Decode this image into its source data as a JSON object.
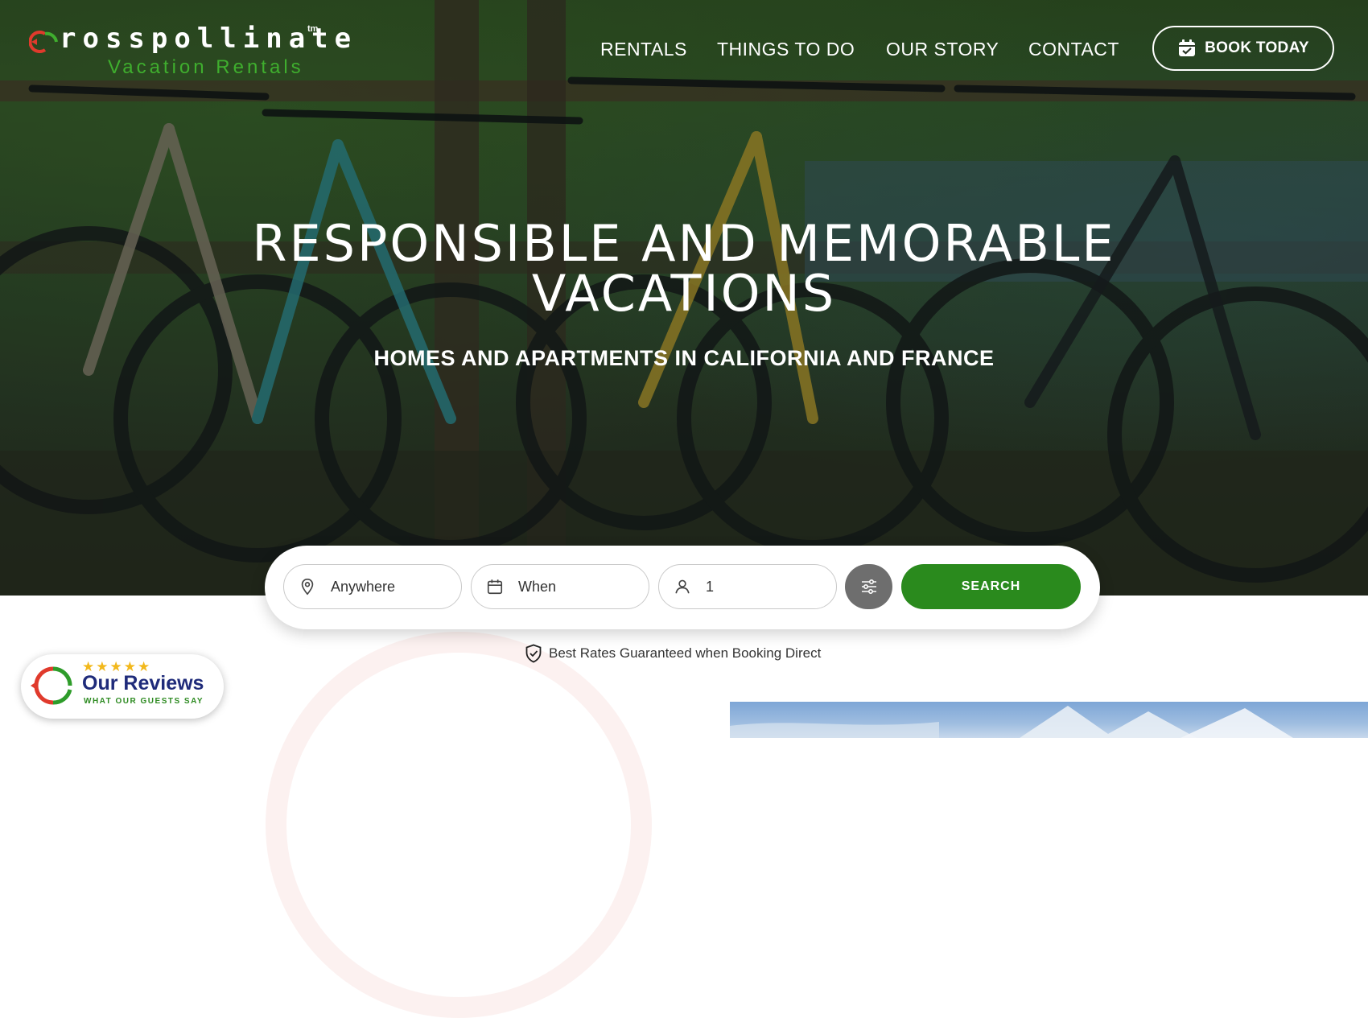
{
  "brand": {
    "name": "rosspollinate",
    "tm": "tm",
    "subtitle": "Vacation Rentals",
    "logo_colors": {
      "red": "#e03a2c",
      "green": "#3fae2e"
    }
  },
  "nav": {
    "items": [
      "RENTALS",
      "THINGS TO DO",
      "OUR STORY",
      "CONTACT"
    ],
    "book_label": "BOOK TODAY",
    "book_icon": "calendar-check-icon"
  },
  "hero": {
    "title_line1": "RESPONSIBLE AND MEMORABLE",
    "title_line2": "VACATIONS",
    "subtitle": "HOMES AND APARTMENTS IN CALIFORNIA AND FRANCE",
    "background": "mountain bikes leaning on a wooden fence"
  },
  "search": {
    "location": {
      "value": "Anywhere",
      "icon": "map-pin-icon"
    },
    "dates": {
      "value": "When",
      "icon": "calendar-icon"
    },
    "guests": {
      "value": "1",
      "icon": "user-icon"
    },
    "filter_icon": "sliders-icon",
    "button_label": "SEARCH",
    "accent": "#2a8a1d"
  },
  "guarantee": {
    "text": "Best Rates Guaranteed when Booking Direct",
    "icon": "shield-check-icon"
  },
  "reviews_badge": {
    "stars": "★★★★★",
    "title": "Our Reviews",
    "subtitle": "WHAT OUR GUESTS SAY",
    "title_color": "#1f2b7a",
    "stars_color": "#f2b81c"
  }
}
